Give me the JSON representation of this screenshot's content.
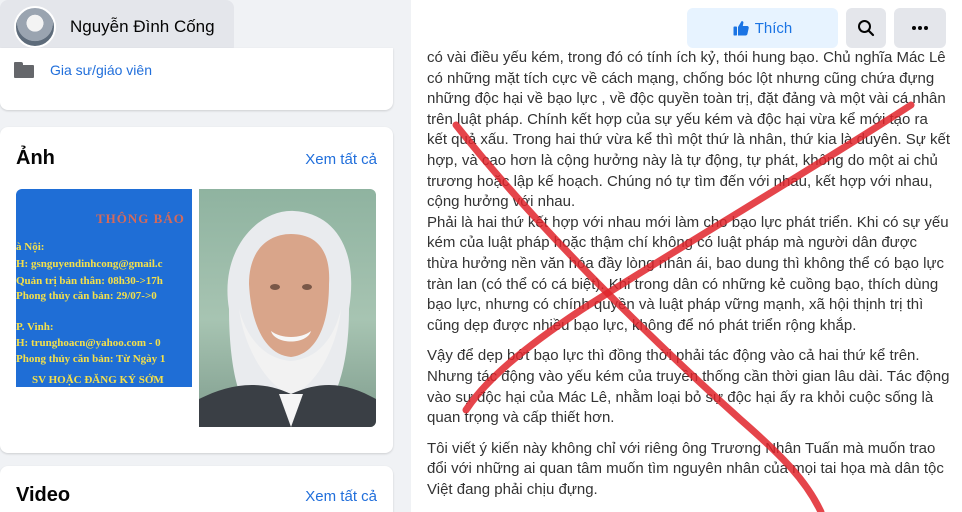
{
  "profile": {
    "name": "Nguyễn Đình Cống"
  },
  "intro": {
    "item_label": "Gia sư/giáo viên"
  },
  "photos": {
    "title": "Ảnh",
    "see_all": "Xem tất cả",
    "notice": {
      "title": "THÔNG BÁO",
      "lines": [
        "à Nội:",
        "H: gsnguyendinhcong@gmail.c",
        "Quản trị bản thân: 08h30->17h",
        "Phong thủy căn bản: 29/07->0",
        "P. Vinh:",
        "H: trunghoacn@yahoo.com - 0",
        "Phong thủy căn bản: Từ Ngày 1"
      ],
      "footer": "SV HOẶC ĐĂNG KÝ SỚM"
    }
  },
  "video": {
    "title": "Video",
    "see_all": "Xem tất cả"
  },
  "actions": {
    "like_label": "Thích"
  },
  "post": {
    "paragraphs": [
      "có vài điều yếu kém, trong đó có tính ích kỷ, thói hung bạo. Chủ nghĩa Mác Lê có những mặt tích cực về cách mạng, chống bóc lột nhưng cũng chứa đựng những độc hại về bạo lực , về độc quyền toàn trị, đặt đảng và một vài cá nhân trên luật pháp. Chính kết hợp của  sự yếu kém và độc hại vừa kể mới tạo ra kết quả xấu. Trong hai thứ vừa kể thì một thứ là nhân, thứ kia là duyên. Sự kết hợp, và cao hơn là cộng hưởng này là tự động, tự phát, không do một ai chủ trương hoặc lập kế hoạch. Chúng nó tự tìm đến với nhau, kết hợp với nhau, cộng hưởng với nhau.",
      "Phải là hai thứ kết hợp với nhau mới làm cho bạo lực phát triển. Khi có sự yếu kém của luật pháp hoặc thậm chí không có luật pháp mà người dân được thừa hưởng nền văn hóa đầy lòng nhân ái, bao dung thì không thể có bạo lực tràn lan (có thể có cá biệt). Khi trong dân có những kẻ cuồng bạo, thích dùng bạo lực, nhưng có chính quyền và luật pháp vững mạnh, xã hội thịnh trị thì cũng dẹp được nhiều bạo lực, không để nó phát triển rộng khắp.",
      "Vậy để dẹp bớt bạo lực thì đồng thời phải tác động vào cả hai  thứ kể trên. Nhưng tác động vào yếu kém của truyền thống cần thời gian lâu dài. Tác động vào sự độc hại của Mác Lê, nhằm loại bỏ sự độc hại ấy ra khỏi cuộc sống là quan trọng và cấp thiết hơn.",
      "Tôi viết ý kiến này không chỉ với riêng ông Trương Nhân Tuấn mà muốn trao đổi với những ai quan tâm muốn tìm nguyên nhân của mọi tai họa mà dân tộc Việt đang phải chịu đựng."
    ]
  },
  "colors": {
    "accent": "#216fdb",
    "cross": "#e0242c",
    "like_bg": "#e7f3ff"
  }
}
